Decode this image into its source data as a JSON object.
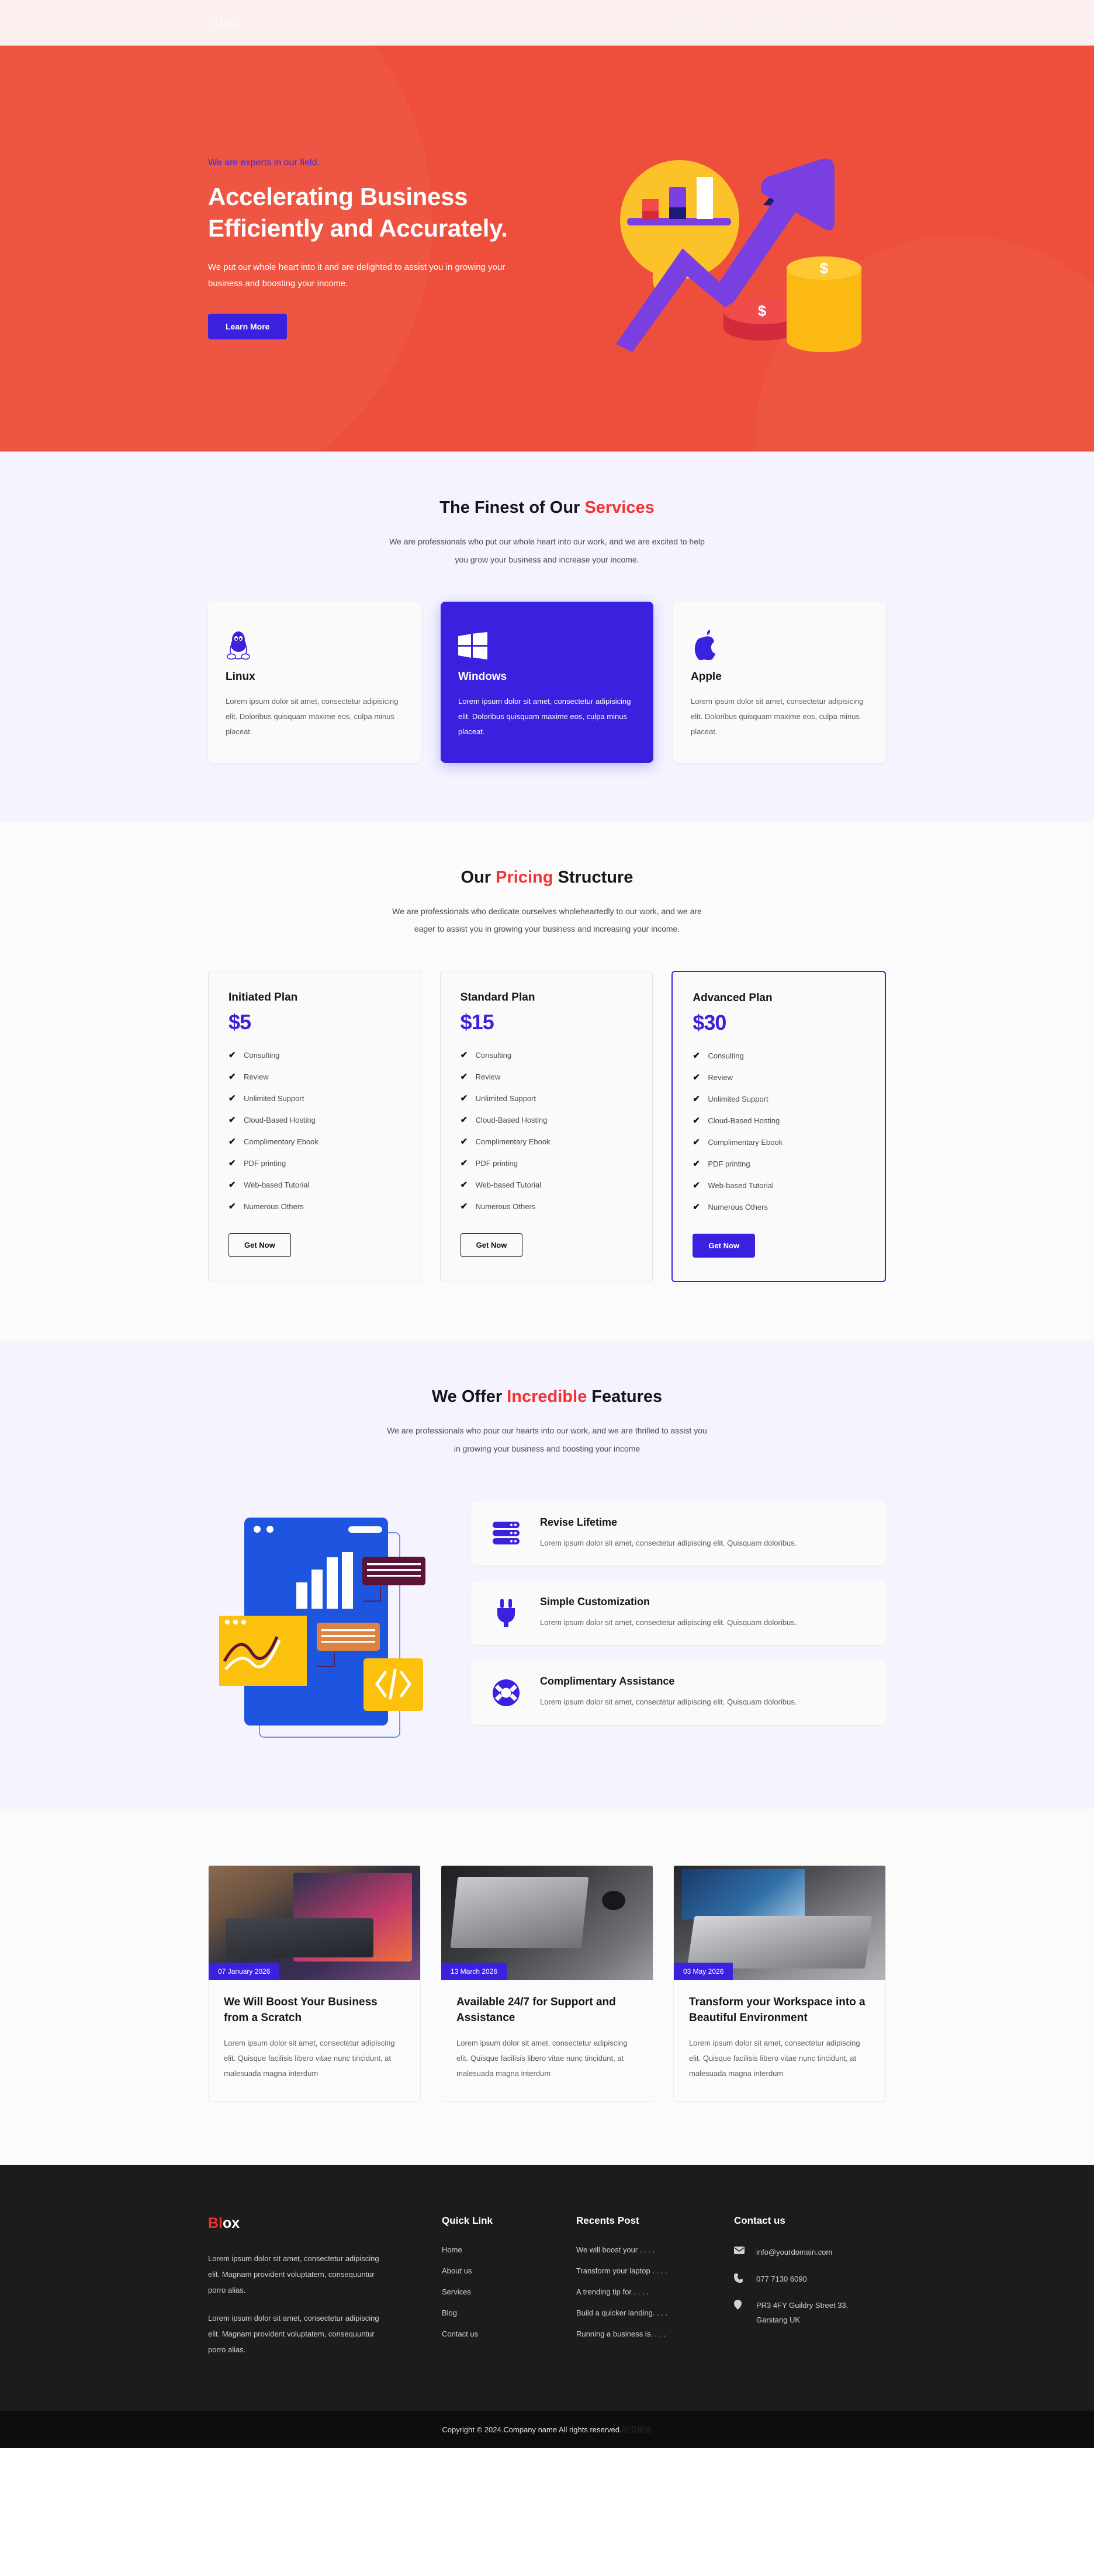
{
  "colors": {
    "primary": "#3a21df",
    "red": "#ee4f3c",
    "accent_red": "#f43333",
    "dark": "#1c1c1c"
  },
  "header": {
    "brand": "Blox",
    "nav": [
      {
        "label": "Home"
      },
      {
        "label": "About"
      },
      {
        "label": "Services"
      },
      {
        "label": "Blog"
      },
      {
        "label": "Contact us"
      }
    ]
  },
  "hero": {
    "eyebrow": "We are experts in our field.",
    "title_line1": "Accelerating Business",
    "title_line2": "Efficiently and Accurately.",
    "paragraph": "We put our whole heart into it and are delighted to assist you in growing your business and boosting your income.",
    "cta": "Learn More",
    "illustration": "business-growth-chart-illustration"
  },
  "services": {
    "title_plain": "The Finest of Our ",
    "title_accent": "Services",
    "subtitle_line1": "We are professionals who put our whole heart into our work, and we are excited to help",
    "subtitle_line2": "you grow your business and increase your income.",
    "cards": [
      {
        "icon": "linux-penguin-icon",
        "name": "Linux",
        "text": "Lorem ipsum dolor sit amet, consectetur adipisicing elit. Doloribus quisquam maxime eos, culpa minus placeat."
      },
      {
        "icon": "windows-logo-icon",
        "name": "Windows",
        "text": "Lorem ipsum dolor sit amet, consectetur adipisicing elit. Doloribus quisquam maxime eos, culpa minus placeat."
      },
      {
        "icon": "apple-logo-icon",
        "name": "Apple",
        "text": "Lorem ipsum dolor sit amet, consectetur adipisicing elit. Doloribus quisquam maxime eos, culpa minus placeat."
      }
    ]
  },
  "pricing": {
    "title_pre": "Our ",
    "title_accent": "Pricing",
    "title_post": " Structure",
    "subtitle_line1": "We are professionals who dedicate ourselves wholeheartedly to our work, and we are",
    "subtitle_line2": "eager to assist you in growing your business and increasing your income.",
    "features": [
      "Consulting",
      "Review",
      "Unlimited Support",
      "Cloud-Based Hosting",
      "Complimentary Ebook",
      "PDF printing",
      "Web-based Tutorial",
      "Numerous Others"
    ],
    "plans": [
      {
        "name": "Initiated Plan",
        "price": "$5",
        "cta": "Get Now"
      },
      {
        "name": "Standard Plan",
        "price": "$15",
        "cta": "Get Now"
      },
      {
        "name": "Advanced Plan",
        "price": "$30",
        "cta": "Get Now"
      }
    ]
  },
  "features": {
    "title_pre": "We Offer ",
    "title_accent": "Incredible",
    "title_post": " Features",
    "subtitle_line1": "We are professionals who pour our hearts into our work, and we are thrilled to assist you",
    "subtitle_line2": "in growing your business and boosting your income",
    "illustration": "web-development-dashboard-illustration",
    "items": [
      {
        "icon": "server-icon",
        "title": "Revise Lifetime",
        "text": "Lorem ipsum dolor sit amet, consectetur adipiscing elit. Quisquam doloribus."
      },
      {
        "icon": "plug-icon",
        "title": "Simple Customization",
        "text": "Lorem ipsum dolor sit amet, consectetur adipiscing elit. Quisquam doloribus."
      },
      {
        "icon": "life-ring-icon",
        "title": "Complimentary Assistance",
        "text": "Lorem ipsum dolor sit amet, consectetur adipiscing elit. Quisquam doloribus."
      }
    ]
  },
  "blog": {
    "posts": [
      {
        "date": "07 January 2026",
        "title": "We Will Boost Your Business from a Scratch",
        "text": "Lorem ipsum dolor sit amet, consectetur adipiscing elit. Quisque facilisis libero vitae nunc tincidunt, at malesuada magna interdum",
        "image": "laptop-on-wooden-desk-photo"
      },
      {
        "date": "13 March 2026",
        "title": "Available 24/7 for Support and Assistance",
        "text": "Lorem ipsum dolor sit amet, consectetur adipiscing elit. Quisque facilisis libero vitae nunc tincidunt, at malesuada magna interdum",
        "image": "laptop-with-mouse-photo"
      },
      {
        "date": "03 May 2026",
        "title": "Transform your Workspace into a Beautiful Environment",
        "text": "Lorem ipsum dolor sit amet, consectetur adipiscing elit. Quisque facilisis libero vitae nunc tincidunt, at malesuada magna interdum",
        "image": "laptop-keyboard-closeup-photo"
      }
    ]
  },
  "footer": {
    "logo_red": "Bl",
    "logo_white": "ox",
    "about_1": "Lorem ipsum dolor sit amet, consectetur adipiscing elit. Magnam provident voluptatem, consequuntur porro alias.",
    "about_2": "Lorem ipsum dolor sit amet, consectetur adipiscing elit. Magnam provident voluptatem, consequuntur porro alias.",
    "quick_link": {
      "heading": "Quick Link",
      "links": [
        "Home",
        "About us",
        "Services",
        "Blog",
        "Contact us"
      ]
    },
    "recents": {
      "heading": "Recents Post",
      "links": [
        "We will boost your . . . .",
        "Transform your laptop . . . .",
        "A trending tip for . . . .",
        "Build a quicker landing. . . .",
        "Running a business is. . . ."
      ]
    },
    "contact": {
      "heading": "Contact us",
      "email": "info@yourdomain.com",
      "phone": "077 7130 6090",
      "address_line1": "PR3 4FY Guildry Street 33,",
      "address_line2": "Garstang UK"
    },
    "copyright": "Copyright © 2024.Company name All rights reserved.",
    "watermark": "网页模板"
  }
}
